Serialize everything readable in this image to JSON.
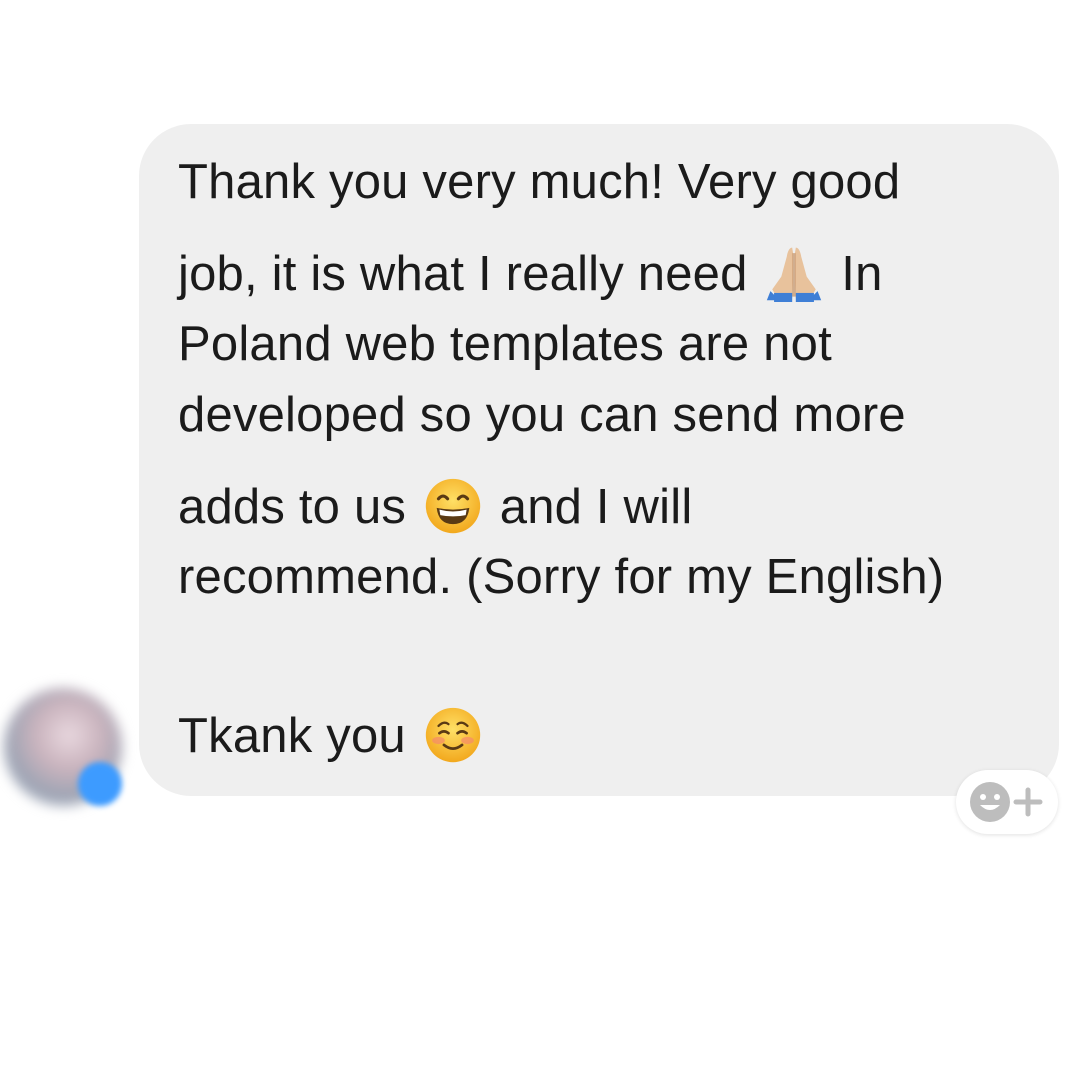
{
  "message": {
    "lines": [
      "Thank you very much! Very good",
      "job, it is what I really need",
      "In",
      "Poland web templates are not",
      "developed so you can send more",
      "adds to us",
      "and I will",
      "recommend. (Sorry for my English)",
      "Tkank you"
    ],
    "emojis": [
      "praying-hands-emoji",
      "grinning-face-emoji",
      "smiling-face-emoji"
    ]
  },
  "sender": {
    "avatar_icon": "avatar",
    "status_color": "#3d9bff"
  },
  "reaction_button": {
    "icon": "add-reaction-icon"
  },
  "colors": {
    "bubble": "#efefef",
    "text": "#1b1b1b"
  }
}
